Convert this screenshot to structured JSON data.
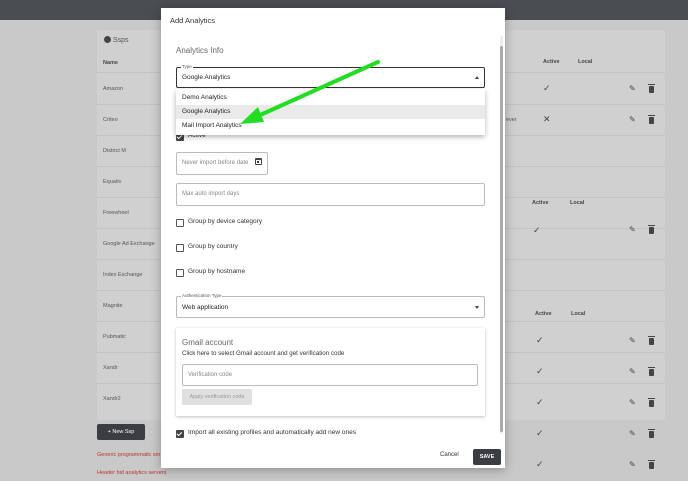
{
  "background": {
    "page_title": "Ssps",
    "columns": {
      "name": "Name",
      "active": "Active",
      "local": "Local"
    },
    "rows": [
      "Amazon",
      "Criteo",
      "District M",
      "Equativ",
      "Freewheel",
      "Google Ad Exchange",
      "Index Exchange",
      "Magnite",
      "Pubmatic",
      "Xandr",
      "Xandr2"
    ],
    "criteo_partial": "ever",
    "new_button": "New Ssp",
    "links": [
      "Generic programmatic sm",
      "Header bid analytics servers"
    ]
  },
  "modal": {
    "title": "Add Analytics",
    "section_title": "Analytics Info",
    "type_field": {
      "label": "Type",
      "value": "Google Analytics"
    },
    "dropdown_options": [
      {
        "label": "Demo Analytics",
        "selected": false
      },
      {
        "label": "Google Analytics",
        "selected": true
      },
      {
        "label": "Mail Import Analytics",
        "selected": false
      }
    ],
    "active_label": "Active",
    "never_import_placeholder": "Never import before date",
    "max_auto_import_placeholder": "Max auto import days",
    "checkboxes": {
      "group_device": "Group by device category",
      "group_country": "Group by country",
      "group_hostname": "Group by hostname",
      "import_all": "Import all existing profiles and automatically add new ones"
    },
    "auth_field": {
      "label": "Authentication Type",
      "value": "Web application"
    },
    "gmail": {
      "title": "Gmail account",
      "description": "Click here to select Gmail account and get verification code",
      "verification_placeholder": "Verification code",
      "apply_button": "Apply verification code"
    },
    "cancel_button": "Cancel",
    "save_button": "SAVE"
  },
  "annotation": {
    "arrow_color": "#22dd22"
  }
}
